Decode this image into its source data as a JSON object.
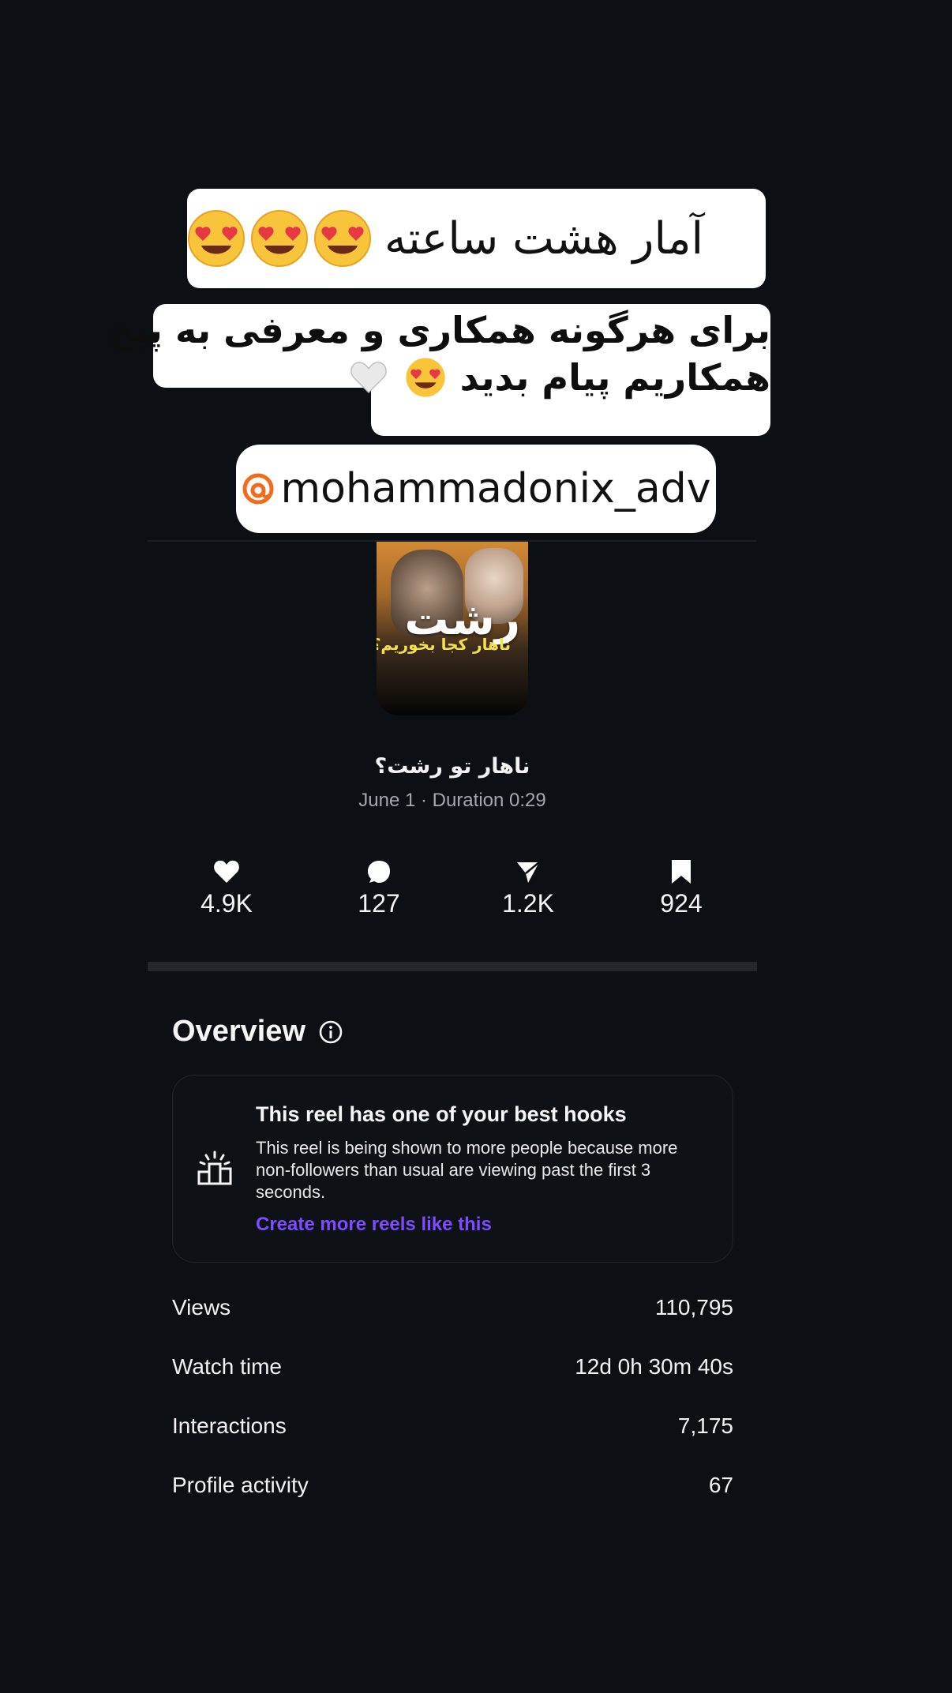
{
  "overlay": {
    "title_text": "آمار هشت ساعته",
    "bio_line1": "برای هرگونه همکاری و معرفی به پیج",
    "bio_line2": "همکاریم پیام بدید",
    "handle": "mohammadonix_adv",
    "emoji_title": "heart-eyes-emoji",
    "emoji_bio": [
      "heart-eyes-emoji",
      "white-heart-emoji"
    ]
  },
  "reel": {
    "thumbnail_text_large": "رشت",
    "thumbnail_text_small": "ناهار کجا بخوریم؟",
    "title": "ناهار تو رشت؟",
    "meta": "June 1 · Duration 0:29"
  },
  "stats": {
    "likes": "4.9K",
    "comments": "127",
    "shares": "1.2K",
    "saves": "924"
  },
  "overview": {
    "title": "Overview",
    "card": {
      "title": "This reel has one of your best hooks",
      "body": "This reel is being shown to more people because more non-followers than usual are viewing past the first 3 seconds.",
      "link": "Create more reels like this"
    },
    "metrics": [
      {
        "label": "Views",
        "value": "110,795"
      },
      {
        "label": "Watch time",
        "value": "12d 0h 30m 40s"
      },
      {
        "label": "Interactions",
        "value": "7,175"
      },
      {
        "label": "Profile activity",
        "value": "67"
      }
    ]
  },
  "colors": {
    "background": "#0c0f14",
    "accent_link": "#7c4dff",
    "threads_orange": "#f26b1d"
  }
}
